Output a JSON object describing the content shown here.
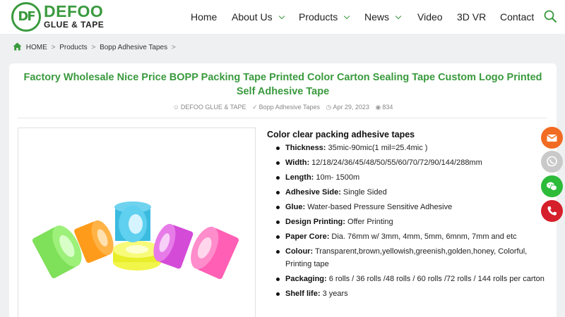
{
  "brand": {
    "mark": "DF",
    "name": "DEFOO",
    "sub": "GLUE & TAPE"
  },
  "nav": {
    "items": [
      {
        "label": "Home",
        "has_dropdown": false
      },
      {
        "label": "About Us",
        "has_dropdown": true
      },
      {
        "label": "Products",
        "has_dropdown": true
      },
      {
        "label": "News",
        "has_dropdown": true
      },
      {
        "label": "Video",
        "has_dropdown": false
      },
      {
        "label": "3D VR",
        "has_dropdown": false
      },
      {
        "label": "Contact",
        "has_dropdown": false
      }
    ],
    "search_icon": "search-icon"
  },
  "breadcrumb": {
    "items": [
      "HOME",
      "Products",
      "Bopp Adhesive Tapes"
    ],
    "separator": ">"
  },
  "product": {
    "title": "Factory Wholesale Nice Price BOPP Packing Tape Printed Color Carton Sealing Tape Custom Logo Printed Self Adhesive Tape",
    "meta": {
      "author": "DEFOO GLUE & TAPE",
      "category": "Bopp Adhesive Tapes",
      "date": "Apr 29, 2023",
      "views": "834"
    },
    "spec_heading": "Color clear packing adhesive tapes",
    "specs": [
      {
        "label": "Thickness:",
        "value": "35mic-90mic(1 mil=25.4mic )"
      },
      {
        "label": "Width:",
        "value": "12/18/24/36/45/48/50/55/60/70/72/90/144/288mm"
      },
      {
        "label": "Length:",
        "value": "10m- 1500m"
      },
      {
        "label": "Adhesive Side:",
        "value": "Single Sided"
      },
      {
        "label": "Glue:",
        "value": "Water-based Pressure Sensitive Adhesive"
      },
      {
        "label": "Design Printing:",
        "value": "Offer Printing"
      },
      {
        "label": "Paper Core:",
        "value": "Dia. 76mm w/ 3mm, 4mm, 5mm, 6mnm, 7mm and etc"
      },
      {
        "label": "Colour:",
        "value": "Transparent,brown,yellowish,greenish,golden,honey, Colorful, Printing tape"
      },
      {
        "label": "Packaging:",
        "value": "6 rolls / 36 rolls /48 rolls / 60 rolls /72 rolls / 144 rolls per carton"
      },
      {
        "label": "Shelf life:",
        "value": "3 years"
      }
    ]
  },
  "float_buttons": [
    {
      "name": "email-icon",
      "color": "#f26b22"
    },
    {
      "name": "whatsapp-icon",
      "color": "#c9c9c9"
    },
    {
      "name": "wechat-icon",
      "color": "#2dbb3a"
    },
    {
      "name": "phone-icon",
      "color": "#d51f2b"
    }
  ],
  "colors": {
    "accent": "#3a9a3e"
  }
}
